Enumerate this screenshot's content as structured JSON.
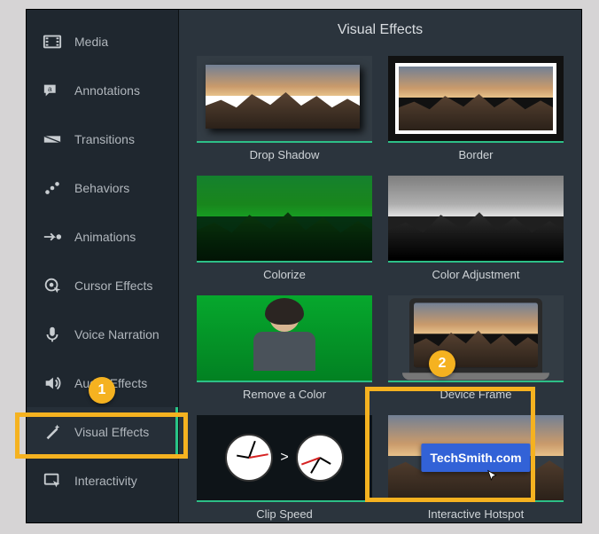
{
  "panel_title": "Visual Effects",
  "sidebar": {
    "items": [
      {
        "label": "Media"
      },
      {
        "label": "Annotations"
      },
      {
        "label": "Transitions"
      },
      {
        "label": "Behaviors"
      },
      {
        "label": "Animations"
      },
      {
        "label": "Cursor Effects"
      },
      {
        "label": "Voice Narration"
      },
      {
        "label": "Audio Effects"
      },
      {
        "label": "Visual Effects"
      },
      {
        "label": "Interactivity"
      }
    ]
  },
  "effects": [
    {
      "label": "Drop Shadow"
    },
    {
      "label": "Border"
    },
    {
      "label": "Colorize"
    },
    {
      "label": "Color Adjustment"
    },
    {
      "label": "Remove a Color"
    },
    {
      "label": "Device Frame"
    },
    {
      "label": "Clip Speed"
    },
    {
      "label": "Interactive Hotspot"
    }
  ],
  "hotspot_button_text": "TechSmith.com",
  "clip_speed_arrow": ">",
  "annotations": {
    "marker1": "1",
    "marker2": "2"
  }
}
